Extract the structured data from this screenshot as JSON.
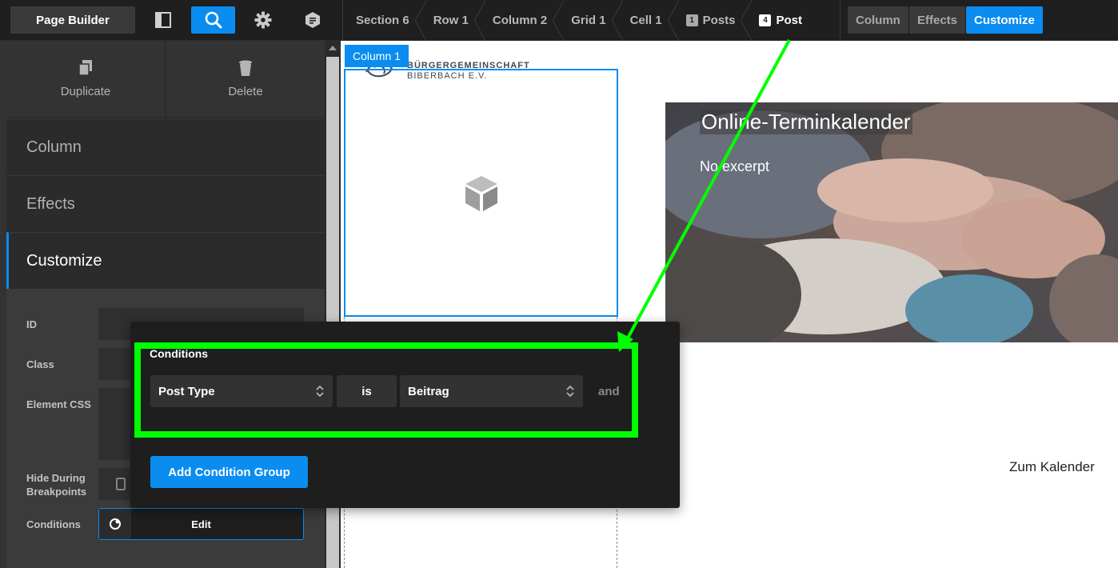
{
  "topbar": {
    "page_builder_label": "Page Builder",
    "icons": [
      "sidebar-panel-icon",
      "search-icon",
      "gear-icon",
      "template-icon"
    ],
    "breadcrumbs": [
      {
        "label": "Section 6",
        "badge": ""
      },
      {
        "label": "Row 1",
        "badge": ""
      },
      {
        "label": "Column 2",
        "badge": ""
      },
      {
        "label": "Grid 1",
        "badge": ""
      },
      {
        "label": "Cell 1",
        "badge": ""
      },
      {
        "label": "Posts",
        "badge": "1"
      },
      {
        "label": "Post",
        "badge": "4"
      }
    ],
    "tabs": [
      "Column",
      "Effects",
      "Customize"
    ],
    "active_tab": "Customize"
  },
  "sidebar": {
    "actions": [
      {
        "label": "Duplicate",
        "icon": "duplicate-icon"
      },
      {
        "label": "Delete",
        "icon": "trash-icon"
      }
    ],
    "tabs": [
      "Column",
      "Effects",
      "Customize"
    ],
    "active_tab": "Customize",
    "fields": {
      "id_label": "ID",
      "class_label": "Class",
      "element_css_label": "Element CSS",
      "hide_label_line1": "Hide During",
      "hide_label_line2": "Breakpoints",
      "conditions_label": "Conditions",
      "conditions_button": "Edit"
    }
  },
  "canvas": {
    "column_label": "Column 1",
    "logo_line1": "BÜRGERGEMEINSCHAFT",
    "logo_line2": "BIBERBACH E.V.",
    "post_title": "Online-Terminkalender",
    "post_excerpt": "No excerpt",
    "link_text": "Zum Kalender"
  },
  "conditions_modal": {
    "title": "Conditions",
    "field_select": "Post Type",
    "operator": "is",
    "value_select": "Beitrag",
    "joiner": "and",
    "add_group_button": "Add Condition Group"
  },
  "colors": {
    "accent": "#0b8cf0",
    "annotation": "#00ff00",
    "dark_bg": "#1f1f1f"
  }
}
